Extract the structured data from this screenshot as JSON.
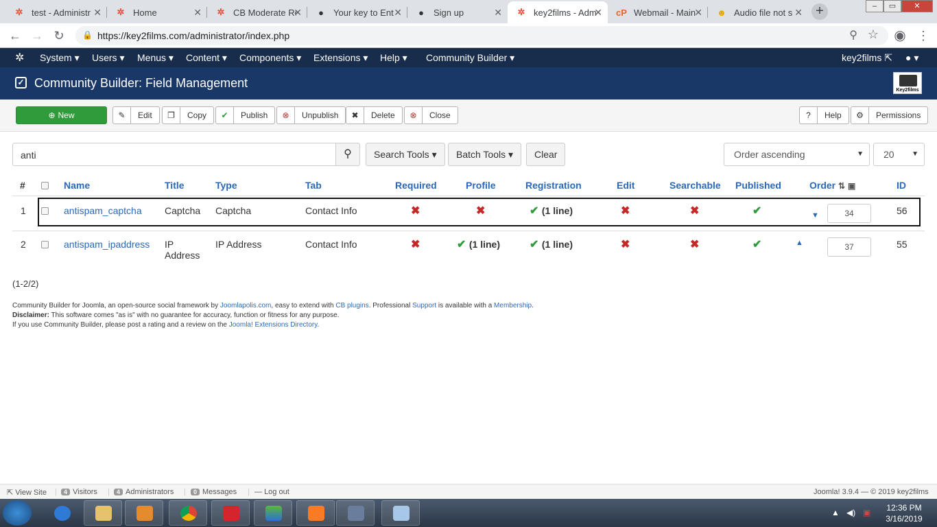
{
  "browser": {
    "tabs": [
      {
        "title": "test - Administr",
        "icon": "joomla-icon"
      },
      {
        "title": "Home",
        "icon": "joomla-icon"
      },
      {
        "title": "CB Moderate Re",
        "icon": "joomla-icon"
      },
      {
        "title": "Your key to Ent",
        "icon": "person-icon"
      },
      {
        "title": "Sign up",
        "icon": "person-icon"
      },
      {
        "title": "key2films - Adm",
        "icon": "joomla-icon"
      },
      {
        "title": "Webmail - Main",
        "icon": "cpanel-icon"
      },
      {
        "title": "Audio file not s",
        "icon": "smiley-icon"
      }
    ],
    "url": "https://key2films.com/administrator/index.php"
  },
  "topnav": {
    "items": [
      "System",
      "Users",
      "Menus",
      "Content",
      "Components",
      "Extensions",
      "Help",
      "Community Builder"
    ],
    "site": "key2films"
  },
  "header": {
    "title": "Community Builder: Field Management",
    "logo_text": "Key2films"
  },
  "toolbar": {
    "new": "New",
    "edit": "Edit",
    "copy": "Copy",
    "publish": "Publish",
    "unpublish": "Unpublish",
    "delete": "Delete",
    "close": "Close",
    "help": "Help",
    "permissions": "Permissions"
  },
  "filters": {
    "search_value": "anti",
    "search_tools": "Search Tools",
    "batch_tools": "Batch Tools",
    "clear": "Clear",
    "order": "Order ascending",
    "limit": "20"
  },
  "table": {
    "headers": {
      "num": "#",
      "name": "Name",
      "title": "Title",
      "type": "Type",
      "tab": "Tab",
      "required": "Required",
      "profile": "Profile",
      "registration": "Registration",
      "edit": "Edit",
      "searchable": "Searchable",
      "published": "Published",
      "order": "Order",
      "id": "ID"
    },
    "rows": [
      {
        "num": "1",
        "name": "antispam_captcha",
        "title": "Captcha",
        "type": "Captcha",
        "tab": "Contact Info",
        "profile_text": "",
        "registration_text": "(1 line)",
        "order": "34",
        "id": "56"
      },
      {
        "num": "2",
        "name": "antispam_ipaddress",
        "title1": "IP",
        "title2": "Address",
        "type": "IP Address",
        "tab": "Contact Info",
        "profile_text": "(1 line)",
        "registration_text": "(1 line)",
        "order": "37",
        "id": "55"
      }
    ]
  },
  "pagination": "(1-2/2)",
  "footer": {
    "line1_a": "Community Builder for Joomla, an open-source social framework by ",
    "line1_link1": "Joomlapolis.com",
    "line1_b": ", easy to extend with ",
    "line1_link2": "CB plugins",
    "line1_c": ". Professional ",
    "line1_link3": "Support",
    "line1_d": " is available with a ",
    "line1_link4": "Membership",
    "line1_e": ".",
    "disclaimer_label": "Disclaimer:",
    "disclaimer": " This software comes \"as is\" with no guarantee for accuracy, function or fitness for any purpose.",
    "line3_a": "If you use Community Builder, please post a rating and a review on the ",
    "line3_link": "Joomla! Extensions Directory",
    "line3_b": "."
  },
  "statusbar": {
    "view_site": "View Site",
    "visitors_count": "4",
    "visitors": "Visitors",
    "admins_count": "4",
    "admins": "Administrators",
    "messages_count": "0",
    "messages": "Messages",
    "logout": "Log out",
    "version": "Joomla! 3.9.4  —  © 2019 key2films"
  },
  "taskbar": {
    "time": "12:36 PM",
    "date": "3/16/2019"
  }
}
